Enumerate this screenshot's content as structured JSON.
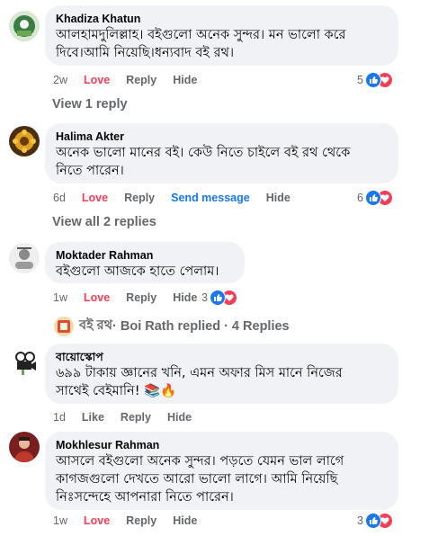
{
  "comments": [
    {
      "author": "Khadiza Khatun",
      "text_lines": [
        "আলহামদুলিল্লাহ। বইগুলো অনেক সুন্দর। মন ভালো করে",
        "দিবে।আমি নিয়েছি।ধন্যবাদ বই রথ।"
      ],
      "time": "2w",
      "love": "Love",
      "reply": "Reply",
      "hide": "Hide",
      "reaction_count": "5"
    },
    {
      "author": "Halima Akter",
      "text_lines": [
        "অনেক ভালো মানের বই। কেউ নিতে চাইলে বই রথ থেকে",
        "নিতে পারেন।"
      ],
      "time": "6d",
      "love": "Love",
      "reply": "Reply",
      "send_message": "Send message",
      "hide": "Hide",
      "reaction_count": "6"
    },
    {
      "author": "Moktader Rahman",
      "text_lines": [
        "বইগুলো আজকে হাতে পেলাম।"
      ],
      "time": "1w",
      "love": "Love",
      "reply": "Reply",
      "hide": "Hide",
      "reaction_count": "3"
    },
    {
      "author": "বায়োস্কোপ",
      "text_lines": [
        "৬৯৯ টাকায় জ্ঞানের খনি, এমন অফার মিস মানে নিজের",
        "সাথেই বেইমানি! 📚🔥"
      ],
      "time": "1d",
      "like": "Like",
      "reply": "Reply",
      "hide": "Hide"
    },
    {
      "author": "Mokhlesur Rahman",
      "text_lines": [
        "আসলে বইগুলো অনেক সুন্দর। পড়তে যেমন ভাল লাগে",
        "কাগজগুলো দেখতে আরো ভালো লাগে। আমি নিয়েছি",
        "নিঃসন্দেহে আপনারা নিতে পারেন।"
      ],
      "time": "1w",
      "love": "Love",
      "reply": "Reply",
      "hide": "Hide",
      "reaction_count": "3"
    }
  ],
  "view_replies": {
    "first": "View 1 reply",
    "second": "View all 2 replies"
  },
  "page_reply": {
    "page_name": "বই রথ",
    "text": " · Boi Rath replied · 4 Replies"
  },
  "colors": {
    "bubble": "#f0f2f5",
    "love": "#f33e58",
    "like_blue": "#1877f2",
    "muted": "#65676b"
  },
  "icons": [
    "like-icon",
    "love-icon",
    "books-emoji-icon",
    "fire-emoji-icon"
  ]
}
